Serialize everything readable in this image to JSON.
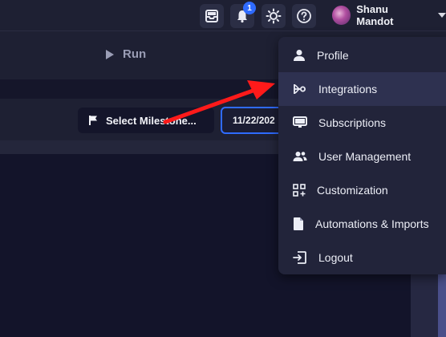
{
  "topbar": {
    "notification_count": "1",
    "user_name": "Shanu Mandot"
  },
  "run": {
    "label": "Run"
  },
  "toolbar": {
    "milestone_label": "Select Milestone...",
    "date_value": "11/22/202"
  },
  "menu": {
    "items": [
      {
        "label": "Profile",
        "icon": "person-icon"
      },
      {
        "label": "Integrations",
        "icon": "integrations-icon"
      },
      {
        "label": "Subscriptions",
        "icon": "monitor-icon"
      },
      {
        "label": "User Management",
        "icon": "users-icon"
      },
      {
        "label": "Customization",
        "icon": "grid-plus-icon"
      },
      {
        "label": "Automations & Imports",
        "icon": "file-icon"
      },
      {
        "label": "Logout",
        "icon": "logout-icon"
      }
    ]
  },
  "colors": {
    "accent": "#2f6bff",
    "annotation_arrow": "#ff1a1a"
  }
}
